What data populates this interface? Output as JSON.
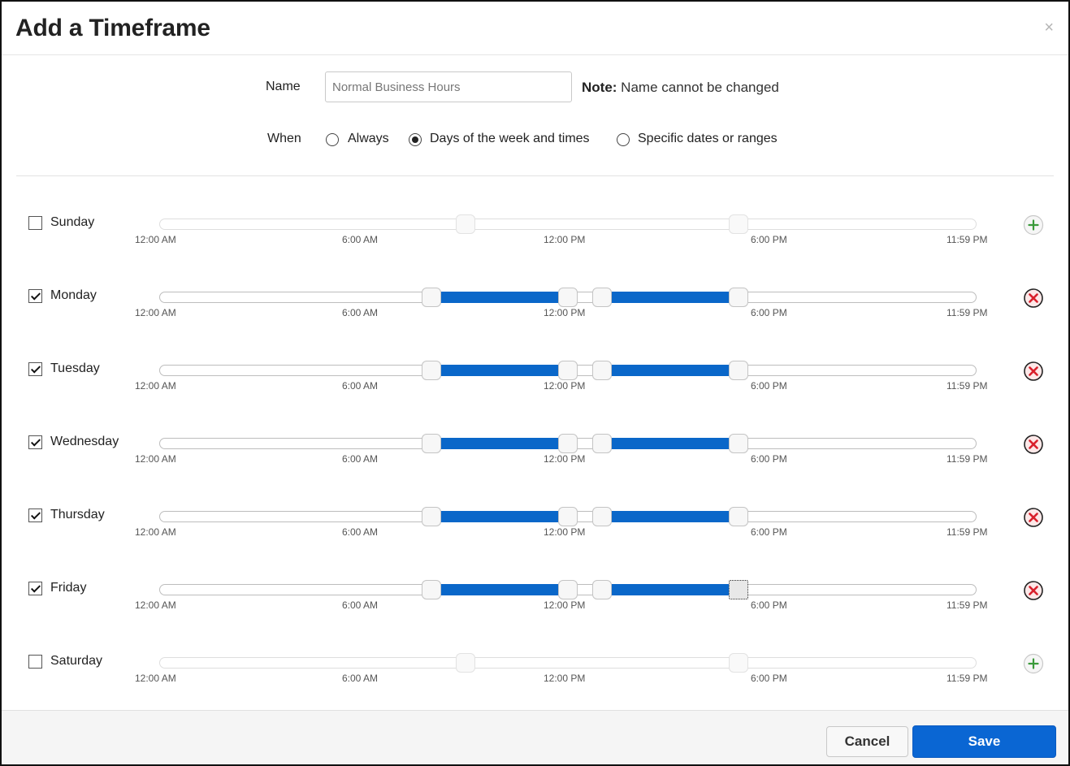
{
  "dialog": {
    "title": "Add a Timeframe",
    "close_glyph": "×"
  },
  "form": {
    "name_label": "Name",
    "name_value": "Normal Business Hours",
    "note_bold": "Note:",
    "note_text": " Name cannot be changed",
    "when_label": "When",
    "when_options": [
      {
        "label": "Always",
        "selected": false
      },
      {
        "label": "Days of the week and times",
        "selected": true
      },
      {
        "label": "Specific dates or ranges",
        "selected": false
      }
    ]
  },
  "tick_labels": [
    "12:00 AM",
    "6:00 AM",
    "12:00 PM",
    "6:00 PM",
    "11:59 PM"
  ],
  "days": [
    {
      "label": "Sunday",
      "checked": false,
      "ranges": [],
      "placeholder_handles_hours": [
        9,
        17
      ],
      "action_icon": "add-icon"
    },
    {
      "label": "Monday",
      "checked": true,
      "ranges": [
        [
          8,
          12
        ],
        [
          13,
          17
        ]
      ],
      "action_icon": "remove-icon"
    },
    {
      "label": "Tuesday",
      "checked": true,
      "ranges": [
        [
          8,
          12
        ],
        [
          13,
          17
        ]
      ],
      "action_icon": "remove-icon"
    },
    {
      "label": "Wednesday",
      "checked": true,
      "ranges": [
        [
          8,
          12
        ],
        [
          13,
          17
        ]
      ],
      "action_icon": "remove-icon"
    },
    {
      "label": "Thursday",
      "checked": true,
      "ranges": [
        [
          8,
          12
        ],
        [
          13,
          17
        ]
      ],
      "action_icon": "remove-icon"
    },
    {
      "label": "Friday",
      "checked": true,
      "ranges": [
        [
          8,
          12
        ],
        [
          13,
          17
        ]
      ],
      "action_icon": "remove-icon",
      "focused_handle": 3
    },
    {
      "label": "Saturday",
      "checked": false,
      "ranges": [],
      "placeholder_handles_hours": [
        9,
        17
      ],
      "action_icon": "add-icon"
    }
  ],
  "footer": {
    "cancel_label": "Cancel",
    "save_label": "Save"
  },
  "colors": {
    "range_fill": "#0a67c9",
    "save_button": "#0a66d3",
    "remove_icon": "#d9202c",
    "add_icon": "#3a9a3a"
  }
}
